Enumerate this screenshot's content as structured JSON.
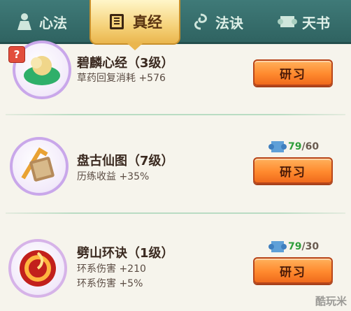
{
  "tabs": [
    {
      "label": "心法",
      "icon": "figure-icon"
    },
    {
      "label": "真经",
      "icon": "book-icon"
    },
    {
      "label": "法诀",
      "icon": "swirl-icon"
    },
    {
      "label": "天书",
      "icon": "scroll-icon"
    }
  ],
  "active_tab": "真经",
  "items": [
    {
      "name": "碧麟心经（3级）",
      "effects": [
        "草药回复消耗 +576"
      ],
      "button": "研习",
      "badge": "?"
    },
    {
      "name": "盘古仙图（7级）",
      "effects": [
        "历练收益 +35%"
      ],
      "button": "研习",
      "cost_have": "79",
      "cost_need": "60"
    },
    {
      "name": "劈山环诀（1级）",
      "effects": [
        "环系伤害 +210",
        "环系伤害 +5%"
      ],
      "button": "研习",
      "cost_have": "79",
      "cost_need": "30"
    }
  ],
  "colors": {
    "tab_bar": "#2f6361",
    "active_tab": "#f5d27a",
    "button": "#ff8a2e",
    "cost_have": "#2e9e3a"
  },
  "watermark": "酷玩米"
}
